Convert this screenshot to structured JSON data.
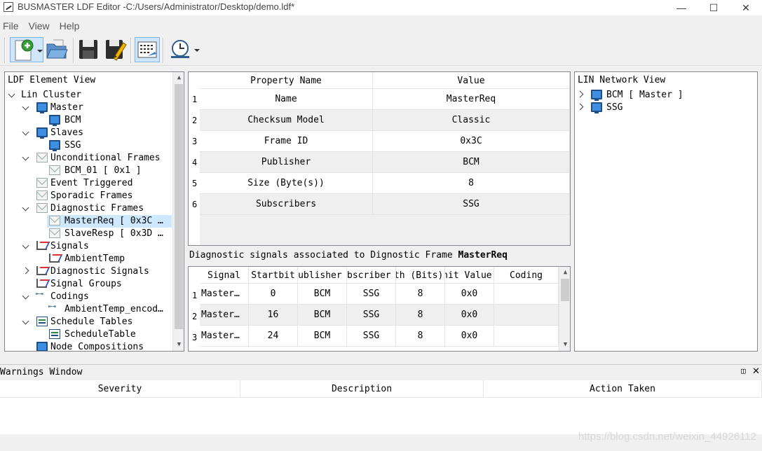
{
  "window": {
    "title": "BUSMASTER LDF Editor -C:/Users/Administrator/Desktop/demo.ldf*",
    "minimize": "—",
    "maximize": "☐",
    "close": "✕"
  },
  "menu": [
    "File",
    "View",
    "Help"
  ],
  "toolbar": {
    "buttons": [
      "new-icon",
      "open-folder-icon",
      "save-icon",
      "save-as-icon",
      "properties-icon",
      "clock-icon"
    ]
  },
  "ldf_view": {
    "title": "LDF Element View",
    "tree": [
      {
        "label": "Lin Cluster"
      },
      {
        "label": "Master"
      },
      {
        "label": "BCM"
      },
      {
        "label": "Slaves"
      },
      {
        "label": "SSG"
      },
      {
        "label": "Unconditional Frames"
      },
      {
        "label": "BCM_01 [ 0x1 ]"
      },
      {
        "label": "Event Triggered"
      },
      {
        "label": "Sporadic Frames"
      },
      {
        "label": "Diagnostic Frames"
      },
      {
        "label": "MasterReq [ 0x3C …"
      },
      {
        "label": "SlaveResp [ 0x3D …"
      },
      {
        "label": "Signals"
      },
      {
        "label": "AmbientTemp"
      },
      {
        "label": "Diagnostic Signals"
      },
      {
        "label": "Signal Groups"
      },
      {
        "label": "Codings"
      },
      {
        "label": "AmbientTemp_encod…"
      },
      {
        "label": "Schedule Tables"
      },
      {
        "label": "ScheduleTable"
      },
      {
        "label": "Node Compositions"
      }
    ]
  },
  "properties": {
    "headers": [
      "Property Name",
      "Value"
    ],
    "rows": [
      {
        "num": "1",
        "name": "Name",
        "value": "MasterReq"
      },
      {
        "num": "2",
        "name": "Checksum Model",
        "value": "Classic"
      },
      {
        "num": "3",
        "name": "Frame ID",
        "value": "0x3C"
      },
      {
        "num": "4",
        "name": "Publisher",
        "value": "BCM"
      },
      {
        "num": "5",
        "name": "Size (Byte(s))",
        "value": "8"
      },
      {
        "num": "6",
        "name": "Subscribers",
        "value": "SSG"
      }
    ]
  },
  "diag": {
    "caption_prefix": "Diagnostic signals associated to Dignostic Frame ",
    "caption_frame": "MasterReq",
    "headers": [
      "Signal",
      "Startbit",
      "Publisher",
      "Subscriber",
      "Length (Bits)",
      "Init Value",
      "Coding"
    ],
    "rows": [
      {
        "num": "1",
        "cells": [
          "Master…",
          "0",
          "BCM",
          "SSG",
          "8",
          "0x0",
          ""
        ]
      },
      {
        "num": "2",
        "cells": [
          "Master…",
          "16",
          "BCM",
          "SSG",
          "8",
          "0x0",
          ""
        ]
      },
      {
        "num": "3",
        "cells": [
          "Master…",
          "24",
          "BCM",
          "SSG",
          "8",
          "0x0",
          ""
        ]
      }
    ]
  },
  "network": {
    "title": "LIN Network View",
    "nodes": [
      "BCM [ Master ]",
      "SSG"
    ]
  },
  "warnings": {
    "title": "Warnings Window",
    "columns": [
      "Severity",
      "Description",
      "Action Taken"
    ]
  },
  "watermark": "https://blog.csdn.net/weixin_44926112"
}
